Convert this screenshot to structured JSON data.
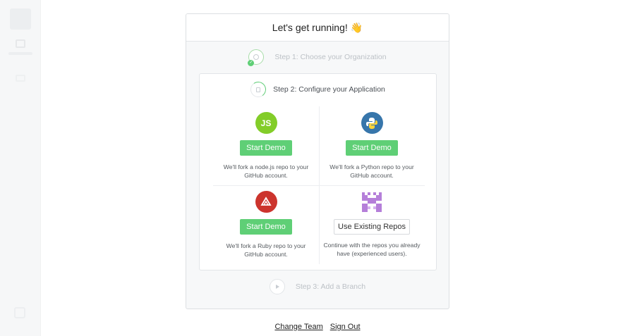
{
  "modal": {
    "title": "Let's get running!",
    "title_emoji": "👋"
  },
  "steps": {
    "step1": {
      "label": "Step 1: Choose your Organization",
      "status": "complete"
    },
    "step2": {
      "label": "Step 2: Configure your Application",
      "status": "active"
    },
    "step3": {
      "label": "Step 3: Add a Branch",
      "status": "pending"
    }
  },
  "options": [
    {
      "icon": "nodejs-icon",
      "logo_text": "JS",
      "button": "Start Demo",
      "description": "We'll fork a node.js repo to your GitHub account."
    },
    {
      "icon": "python-icon",
      "button": "Start Demo",
      "description": "We'll fork a Python repo to your GitHub account."
    },
    {
      "icon": "ruby-icon",
      "button": "Start Demo",
      "description": "We'll fork a Ruby repo to your GitHub account."
    },
    {
      "icon": "repos-pixel-icon",
      "button": "Use Existing Repos",
      "description": "Continue with the repos you already have (experienced users)."
    }
  ],
  "footer": {
    "change_team": "Change Team",
    "sign_out": "Sign Out"
  },
  "colors": {
    "primary_button": "#5fcf76",
    "node": "#83cd29",
    "python": "#3776ab",
    "ruby": "#cc342d"
  }
}
